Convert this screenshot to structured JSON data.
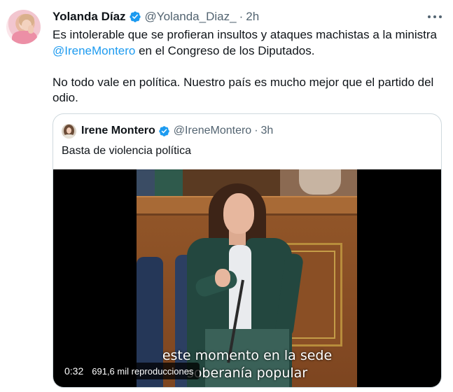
{
  "tweet": {
    "author_name": "Yolanda Díaz",
    "author_handle": "@Yolanda_Diaz_",
    "separator": "·",
    "time": "2h",
    "text_line1": "Es intolerable que se profieran insultos y ataques machistas a la ministra",
    "mention": "@IreneMontero",
    "text_line2_rest": " en el Congreso de los Diputados.",
    "text_para2_line1": "No todo vale en política. Nuestro país es mucho mejor que el partido del",
    "text_para2_line2": "odio."
  },
  "quote": {
    "author_name": "Irene Montero",
    "author_handle": "@IreneMontero",
    "separator": "·",
    "time": "3h",
    "text": "Basta de violencia política",
    "video": {
      "caption_line1": "este momento en la sede",
      "caption_line2": "soberanía popular",
      "duration": "0:32",
      "views": "691,6 mil reproducciones"
    }
  },
  "colors": {
    "link": "#1d9bf0",
    "verified": "#1d9bf0",
    "muted": "#536471",
    "border": "#cfd9de"
  },
  "icons": {
    "verified": "verified-badge-icon",
    "more": "more-icon"
  }
}
